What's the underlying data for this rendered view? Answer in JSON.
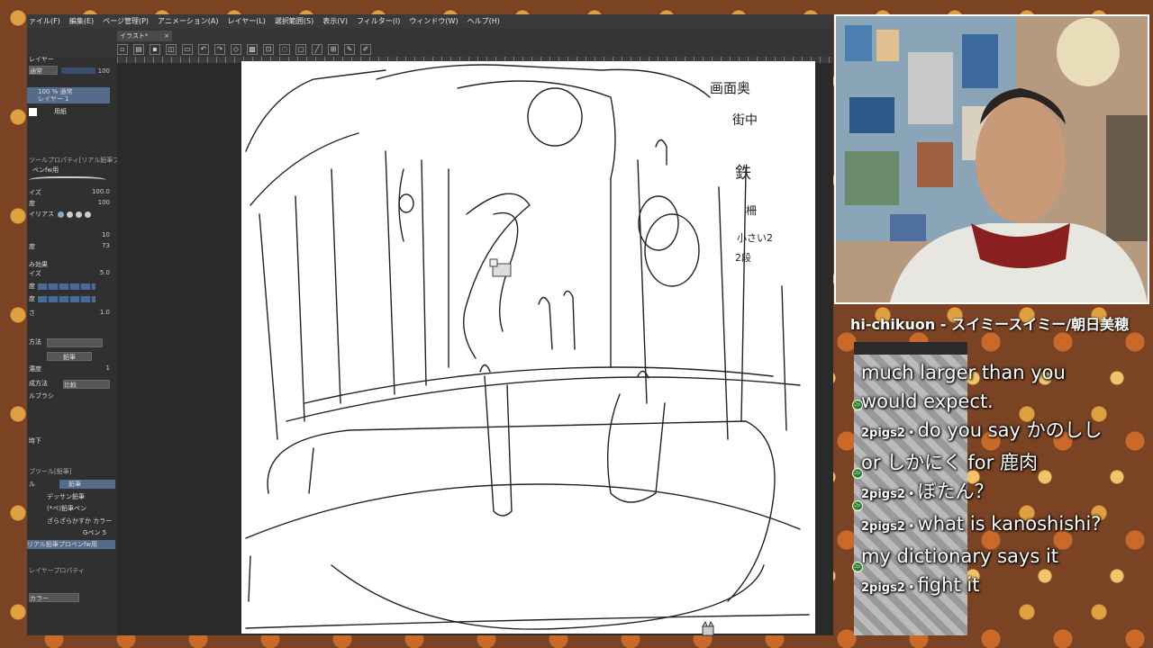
{
  "menubar": {
    "items": [
      "ァイル(F)",
      "編集(E)",
      "ページ管理(P)",
      "アニメーション(A)",
      "レイヤー(L)",
      "選択範囲(S)",
      "表示(V)",
      "フィルター(I)",
      "ウィンドウ(W)",
      "ヘルプ(H)"
    ]
  },
  "document_tab": {
    "title": "イラスト*",
    "close": "×"
  },
  "layer_panel": {
    "title": "レイヤー",
    "blend_mode": "通常",
    "opacity": "100",
    "layer1_name": "100 % 通常",
    "layer1_sub": "レイヤー 1",
    "paper_label": "用紙"
  },
  "tool_property": {
    "header": "ツールプロパティ[リアル鉛筆プロペンfw用]",
    "brush_name": "ベンfw用",
    "size_label": "イズ",
    "size_value": "100.0",
    "density_label": "度",
    "density_value": "100",
    "aa_label": "イリアス",
    "hardness_value": "10",
    "hardness_label": "度",
    "stab_value": "73",
    "ink_label": "み効果",
    "ink_size_label": "イズ",
    "ink_size_value": "5.0",
    "row1": "度",
    "row2": "度",
    "row3": "さ",
    "row3_value": "1.0",
    "pen_label": "方法",
    "pen_value": "鉛筆",
    "density2_label": "濃度",
    "density2_value": "1",
    "method_label": "成方法",
    "method_value": "比較",
    "brush_label": "ルブラシ",
    "lower_label": "時下"
  },
  "sub_tool": {
    "header": "ブツール[鉛筆]",
    "tab1": "ル",
    "tab2": "鉛筆",
    "brushes": [
      "デッサン鉛筆",
      "(*ペ)鉛筆ペン",
      "ざらざらかすか カラー",
      "Gペン 5",
      "リアル鉛筆プロペンfw用"
    ]
  },
  "layer_property": {
    "header": "レイヤープロパティ",
    "color_label": "カラー"
  },
  "song": {
    "text": "hi-chikuon - スイミースイミー/朝日美穂"
  },
  "chat": {
    "messages": [
      {
        "user": "",
        "text": "much larger than you would expect."
      },
      {
        "user": "2pigs2",
        "text": "do you say かのしし or しかにく for 鹿肉"
      },
      {
        "user": "2pigs2",
        "text": "ぼたん？"
      },
      {
        "user": "2pigs2",
        "text": "what is kanoshishi? my dictionary says it"
      },
      {
        "user": "2pigs2",
        "text": "fight it"
      }
    ],
    "separator": "•"
  },
  "sketch_notes": {
    "note1": "画面奥",
    "note2": "街中",
    "note3": "鉄",
    "note4": "柵",
    "note5": "小さい2",
    "note6": "2段"
  },
  "colors": {
    "app_bg": "#2b2b2b",
    "canvas": "#ffffff",
    "chat_badge": "#3aaa3a",
    "accent_selection": "#556b8a"
  }
}
